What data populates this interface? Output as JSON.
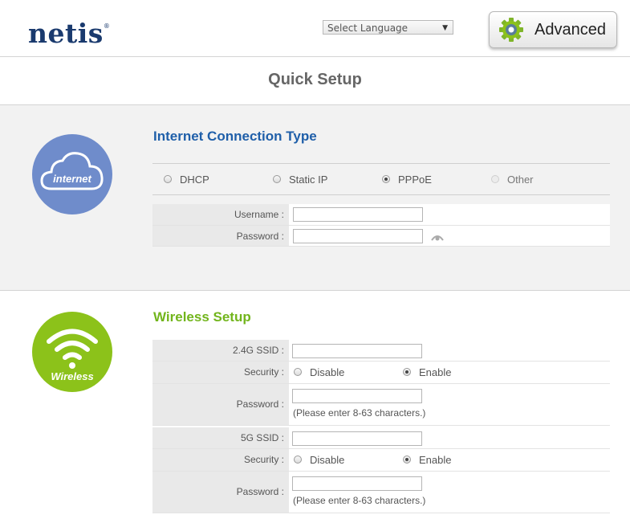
{
  "header": {
    "logo": "netis",
    "logo_mark": "®",
    "language_select": {
      "selected": "Select Language"
    },
    "advanced_button": "Advanced"
  },
  "page_title": "Quick Setup",
  "internet": {
    "icon_label": "internet",
    "heading": "Internet Connection Type",
    "types": [
      {
        "label": "DHCP",
        "state": "unchecked"
      },
      {
        "label": "Static IP",
        "state": "unchecked"
      },
      {
        "label": "PPPoE",
        "state": "checked"
      },
      {
        "label": "Other",
        "state": "disabled"
      }
    ],
    "username_label": "Username :",
    "username_value": "",
    "password_label": "Password :",
    "password_value": ""
  },
  "wireless": {
    "icon_label": "Wireless",
    "heading": "Wireless Setup",
    "band24": {
      "ssid_label": "2.4G SSID :",
      "ssid_value": "",
      "security_label": "Security :",
      "disable_label": "Disable",
      "enable_label": "Enable",
      "selected": "Enable",
      "password_label": "Password :",
      "password_value": "",
      "password_hint": "(Please enter 8-63 characters.)"
    },
    "band5": {
      "ssid_label": "5G SSID :",
      "ssid_value": "",
      "security_label": "Security :",
      "disable_label": "Disable",
      "enable_label": "Enable",
      "selected": "Enable",
      "password_label": "Password :",
      "password_value": "",
      "password_hint": "(Please enter 8-63 characters.)"
    }
  },
  "colors": {
    "brand_navy": "#1a3a6e",
    "internet_blue": "#6f8ccb",
    "heading_blue": "#1f5fa9",
    "wireless_green": "#8cc21a",
    "heading_green": "#72b51c"
  }
}
